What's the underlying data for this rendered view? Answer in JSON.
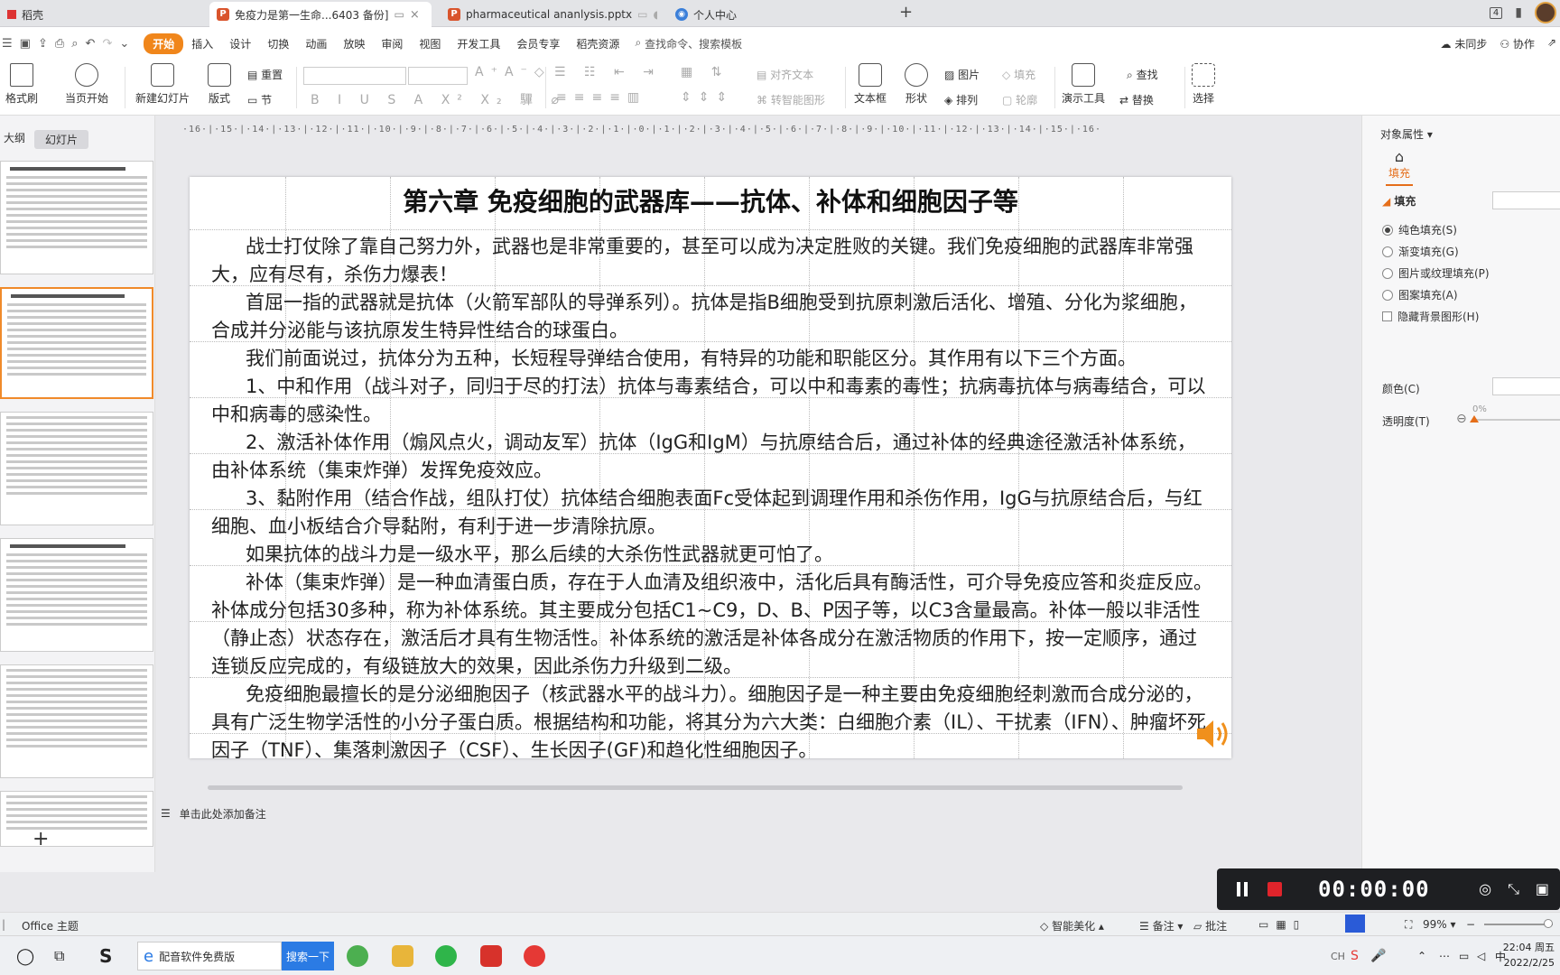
{
  "tabs": {
    "home": "稻壳",
    "doc1": "免疫力是第一生命...6403 备份]",
    "doc2": "pharmaceutical ananlysis.pptx",
    "doc3": "个人中心",
    "window_count": "4"
  },
  "menu": {
    "items": [
      "开始",
      "插入",
      "设计",
      "切换",
      "动画",
      "放映",
      "审阅",
      "视图",
      "开发工具",
      "会员专享",
      "稻壳资源"
    ],
    "search_placeholder": "查找命令、搜索模板",
    "sync": "未同步",
    "collab": "协作"
  },
  "toolbar": {
    "format_painter": "格式刷",
    "play_from_current": "当页开始",
    "new_slide": "新建幻灯片",
    "layout": "版式",
    "section": "节",
    "reset": "重置",
    "align_text": "对齐文本",
    "convert_smartart": "转智能图形",
    "textbox": "文本框",
    "shape": "形状",
    "picture": "图片",
    "arrange": "排列",
    "fill": "填充",
    "outline": "轮廓",
    "presenter_tools": "演示工具",
    "find": "查找",
    "replace": "替换",
    "select": "选择"
  },
  "left_panel": {
    "tab_outline": "大纲",
    "tab_slides": "幻灯片"
  },
  "slide": {
    "title": "第六章  免疫细胞的武器库——抗体、补体和细胞因子等",
    "paragraphs": [
      "战士打仗除了靠自己努力外，武器也是非常重要的，甚至可以成为决定胜败的关键。我们免疫细胞的武器库非常强大，应有尽有，杀伤力爆表！",
      "首屈一指的武器就是抗体（火箭军部队的导弹系列）。抗体是指B细胞受到抗原刺激后活化、增殖、分化为浆细胞，合成并分泌能与该抗原发生特异性结合的球蛋白。",
      "我们前面说过，抗体分为五种，长短程导弹结合使用，有特异的功能和职能区分。其作用有以下三个方面。",
      "1、中和作用（战斗对子，同归于尽的打法）抗体与毒素结合，可以中和毒素的毒性；抗病毒抗体与病毒结合，可以中和病毒的感染性。",
      "2、激活补体作用（煽风点火，调动友军）抗体（IgG和IgM）与抗原结合后，通过补体的经典途径激活补体系统，由补体系统（集束炸弹）发挥免疫效应。",
      "3、黏附作用（结合作战，组队打仗）抗体结合细胞表面Fc受体起到调理作用和杀伤作用，IgG与抗原结合后，与红细胞、血小板结合介导黏附，有利于进一步清除抗原。",
      "如果抗体的战斗力是一级水平，那么后续的大杀伤性武器就更可怕了。",
      "补体（集束炸弹）是一种血清蛋白质，存在于人血清及组织液中，活化后具有酶活性，可介导免疫应答和炎症反应。补体成分包括30多种，称为补体系统。其主要成分包括C1~C9，D、B、P因子等，以C3含量最高。补体一般以非活性（静止态）状态存在，激活后才具有生物活性。补体系统的激活是补体各成分在激活物质的作用下，按一定顺序，通过连锁反应完成的，有级链放大的效果，因此杀伤力升级到二级。",
      "免疫细胞最擅长的是分泌细胞因子（核武器水平的战斗力）。细胞因子是一种主要由免疫细胞经刺激而合成分泌的，具有广泛生物学活性的小分子蛋白质。根据结构和功能，将其分为六大类：白细胞介素（IL）、干扰素（IFN）、肿瘤坏死因子（TNF）、集落刺激因子（CSF）、生长因子(GF)和趋化性细胞因子。"
    ]
  },
  "notes_placeholder": "单击此处添加备注",
  "right_panel": {
    "title": "对象属性",
    "tab_fill": "填充",
    "section_fill": "填充",
    "options": [
      "纯色填充(S)",
      "渐变填充(G)",
      "图片或纹理填充(P)",
      "图案填充(A)"
    ],
    "hide_bg": "隐藏背景图形(H)",
    "color_label": "颜色(C)",
    "transparency_label": "透明度(T)",
    "transparency_value": "0%"
  },
  "statusbar": {
    "theme": "Office 主题",
    "beautify": "智能美化",
    "notes": "备注",
    "comments": "批注",
    "zoom": "99%"
  },
  "recorder": {
    "time": "00:00:00"
  },
  "taskbar": {
    "search_text": "配音软件免费版",
    "search_button": "搜索一下",
    "time": "22:04 周五",
    "date": "2022/2/25"
  }
}
